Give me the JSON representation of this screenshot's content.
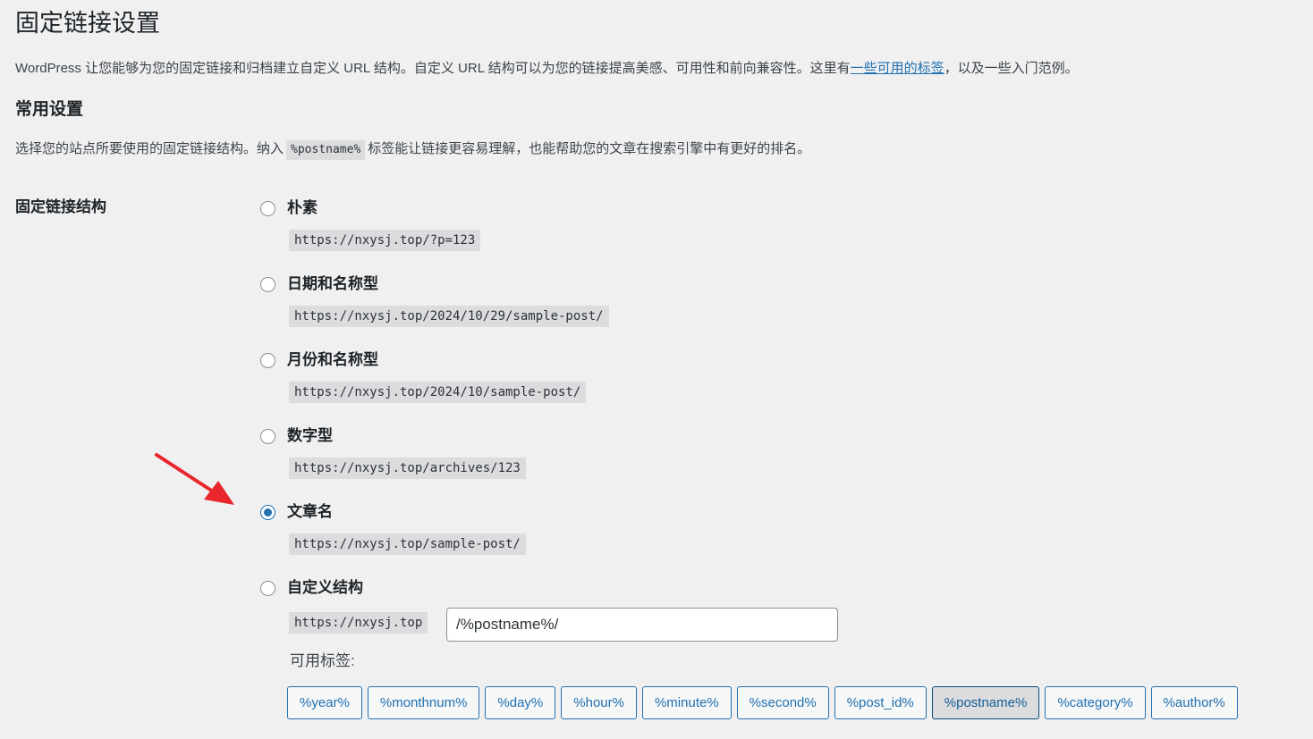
{
  "page": {
    "title": "固定链接设置",
    "intro_before": "WordPress 让您能够为您的固定链接和归档建立自定义 URL 结构。自定义 URL 结构可以为您的链接提高美感、可用性和前向兼容性。这里有",
    "intro_link": "一些可用的标签",
    "intro_after": "，以及一些入门范例。"
  },
  "common": {
    "title": "常用设置",
    "desc_before": "选择您的站点所要使用的固定链接结构。纳入",
    "desc_code": "%postname%",
    "desc_after": "标签能让链接更容易理解，也能帮助您的文章在搜索引擎中有更好的排名。"
  },
  "structure": {
    "label": "固定链接结构",
    "options": [
      {
        "label": "朴素",
        "example": "https://nxysj.top/?p=123",
        "checked": false
      },
      {
        "label": "日期和名称型",
        "example": "https://nxysj.top/2024/10/29/sample-post/",
        "checked": false
      },
      {
        "label": "月份和名称型",
        "example": "https://nxysj.top/2024/10/sample-post/",
        "checked": false
      },
      {
        "label": "数字型",
        "example": "https://nxysj.top/archives/123",
        "checked": false
      },
      {
        "label": "文章名",
        "example": "https://nxysj.top/sample-post/",
        "checked": true
      },
      {
        "label": "自定义结构",
        "checked": false
      }
    ],
    "custom_prefix": "https://nxysj.top",
    "custom_value": "/%postname%/",
    "tags_label": "可用标签:",
    "tags": [
      "%year%",
      "%monthnum%",
      "%day%",
      "%hour%",
      "%minute%",
      "%second%",
      "%post_id%",
      "%postname%",
      "%category%",
      "%author%"
    ],
    "active_tag": "%postname%"
  },
  "colors": {
    "accent": "#2271b1",
    "annotation_arrow": "#e8262b",
    "background": "#f0f0f1"
  }
}
